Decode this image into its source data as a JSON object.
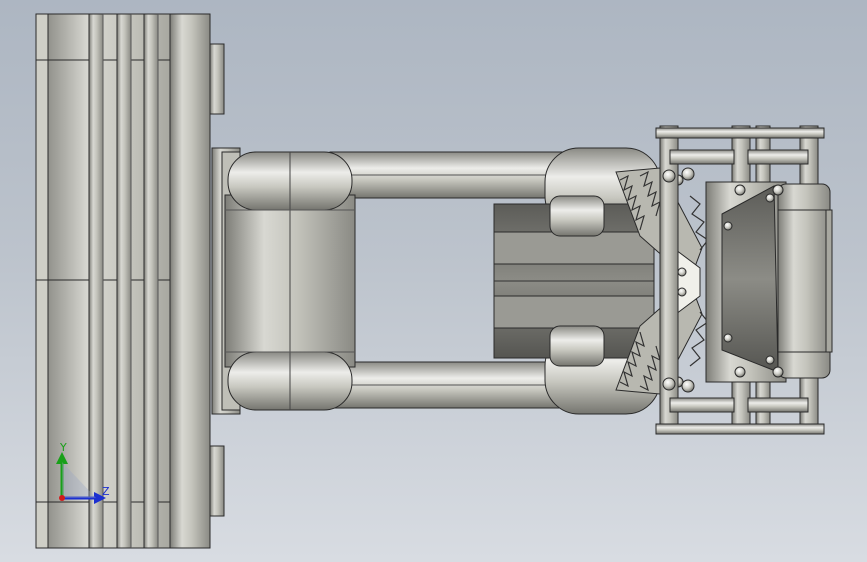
{
  "viewport": {
    "background_top": "#adb6c2",
    "background_bottom": "#d8dce2"
  },
  "model": {
    "description_icon": "cad-assembly",
    "metal_light": "#e6e6e0",
    "metal_mid": "#bdbdb5",
    "metal_dark": "#6e6e68",
    "edge_color": "#2a2a2a"
  },
  "triad": {
    "y_label": "Y",
    "z_label": "Z",
    "y_color": "#19a019",
    "z_color": "#1b2fd0",
    "origin_color": "#d01b1b"
  }
}
